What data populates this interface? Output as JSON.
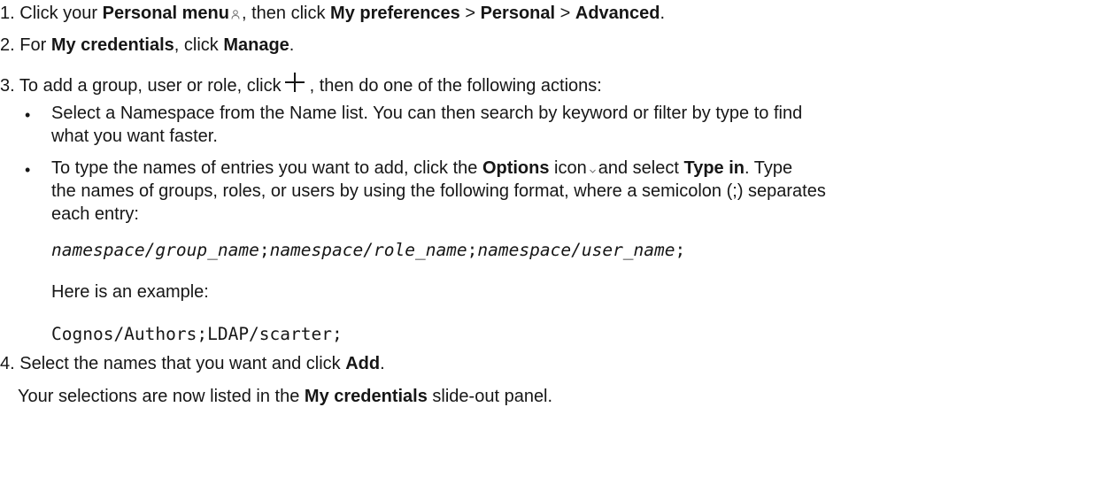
{
  "steps": {
    "s1": {
      "num": "1.",
      "t1": "Click your ",
      "personal_menu": "Personal menu",
      "person_icon": "person-icon",
      "t2": ", then click ",
      "my_preferences": "My preferences",
      "sep1": " > ",
      "personal": "Personal",
      "sep2": " > ",
      "advanced": "Advanced",
      "end": "."
    },
    "s2": {
      "num": "2.",
      "t1": "For ",
      "my_credentials": "My credentials",
      "t2": ", click ",
      "manage": "Manage",
      "end": "."
    },
    "s3": {
      "num": "3.",
      "t1": "To add a group, user or role, click",
      "plus_icon": "plus-icon",
      "t2": ", then do one of the following actions:"
    },
    "bullet1": {
      "line1": "Select a Namespace from the Name list. You can then search by keyword or filter by type to find",
      "line2": "what you want faster."
    },
    "bullet2": {
      "t1": "To type the names of entries you want to add, click the ",
      "options": "Options",
      "t2": " icon",
      "chevron_icon": "chevron-down-icon",
      "t3": "and select ",
      "type_in": "Type in",
      "t4": ". Type",
      "line2": "the names of groups, roles, or users by using the following format, where a semicolon (;) separates",
      "line3": "each entry:"
    },
    "format": {
      "ns1": "namespace",
      "slash1": "/",
      "group": "group_name",
      "semi1": ";",
      "ns2": "namespace",
      "slash2": "/",
      "role": "role_name",
      "semi2": ";",
      "ns3": "namespace",
      "slash3": "/",
      "user": "user_name",
      "semi3": ";"
    },
    "example_intro": "Here is an example:",
    "example_code": "Cognos/Authors;LDAP/scarter;",
    "s4": {
      "num": "4.",
      "t1": "Select the names that you want and click ",
      "add": "Add",
      "end": ".",
      "line2_t1": "Your selections are now listed in the ",
      "my_credentials": "My credentials",
      "line2_t2": " slide-out panel."
    }
  }
}
